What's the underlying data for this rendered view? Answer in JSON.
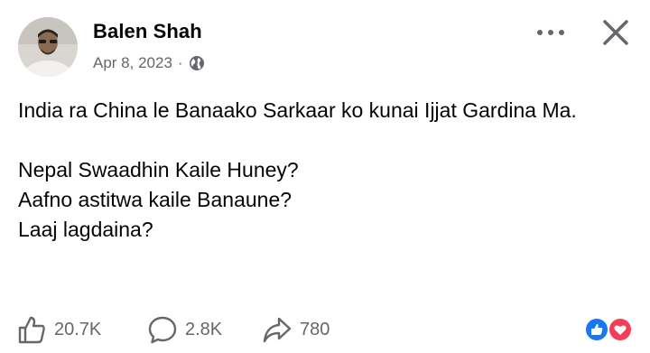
{
  "post": {
    "author": "Balen Shah",
    "date": "Apr 8, 2023",
    "separator": "·",
    "audience_icon": "globe-icon",
    "paragraphs": [
      [
        "India ra China le Banaako Sarkaar ko kunai Ijjat Gardina Ma."
      ],
      [
        "Nepal Swaadhin Kaile Huney?",
        "Aafno astitwa kaile Banaune?",
        "Laaj lagdaina?"
      ]
    ]
  },
  "header_actions": {
    "more_icon": "more-horizontal-icon",
    "close_icon": "close-icon"
  },
  "stats": {
    "likes": "20.7K",
    "comments": "2.8K",
    "shares": "780"
  },
  "reaction_icons": [
    "like-reaction-icon",
    "love-reaction-icon"
  ],
  "colors": {
    "text": "#050505",
    "secondary": "#65676b",
    "like_blue": "#1877f2",
    "love_red": "#f33e58"
  }
}
